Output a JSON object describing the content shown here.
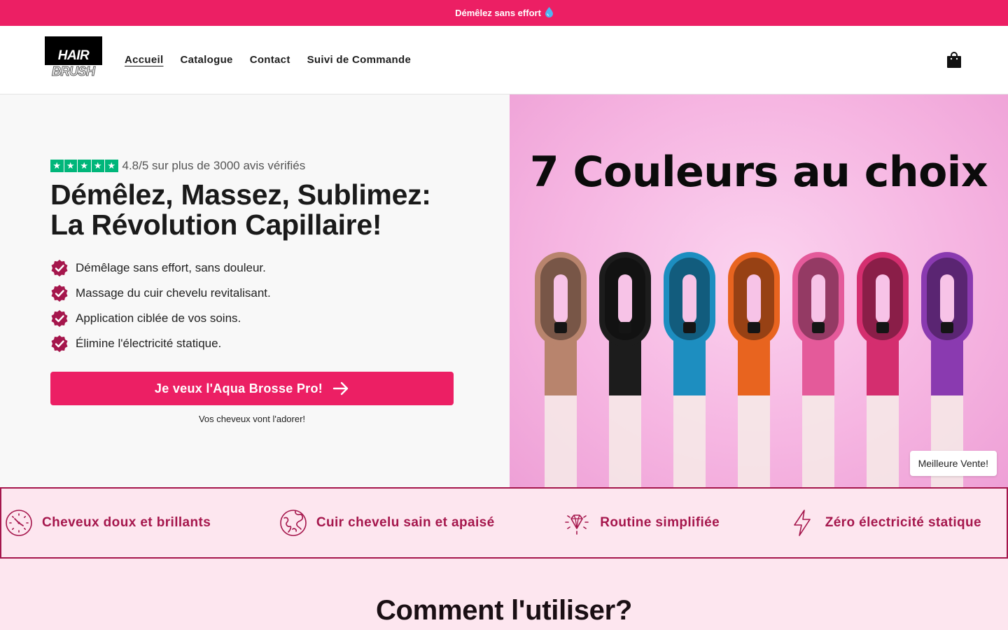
{
  "announcement": {
    "text": "Démêlez sans effort",
    "icon": "droplet-icon"
  },
  "header": {
    "logo_top": "HAIR",
    "logo_bottom": "BRUSH",
    "nav": [
      "Accueil",
      "Catalogue",
      "Contact",
      "Suivi de Commande"
    ],
    "cart_icon": "shopping-bag-icon"
  },
  "hero": {
    "rating_text": "4.8/5 sur plus de 3000 avis vérifiés",
    "headline_line1": "Démêlez, Massez, Sublimez:",
    "headline_line2": "La Révolution Capillaire!",
    "features": [
      "Démêlage sans effort, sans douleur.",
      "Massage du cuir chevelu revitalisant.",
      "Application ciblée de vos soins.",
      "Élimine l'électricité statique."
    ],
    "cta_label": "Je veux l'Aqua Brosse Pro!",
    "cta_subtext": "Vos cheveux vont l'adorer!",
    "image_title": "7 Couleurs au choix",
    "image_badge": "Meilleure Vente!",
    "brush_colors": [
      "#b8846d",
      "#1c1c1c",
      "#1d8ec0",
      "#e8641f",
      "#e45a9a",
      "#d42e6f",
      "#8a3ab0"
    ]
  },
  "benefits": [
    {
      "label": "Cheveux doux et brillants",
      "icon": "clock-icon"
    },
    {
      "label": "Cuir chevelu sain et apaisé",
      "icon": "globe-icon"
    },
    {
      "label": "Routine simplifiée",
      "icon": "diamond-icon"
    },
    {
      "label": "Zéro électricité statique",
      "icon": "lightning-icon"
    }
  ],
  "how_to": {
    "title": "Comment l'utiliser?"
  },
  "colors": {
    "brand": "#ec1f64",
    "accent_dark": "#a5164c",
    "star_green": "#00b67a",
    "band_bg": "#fde6ef"
  }
}
